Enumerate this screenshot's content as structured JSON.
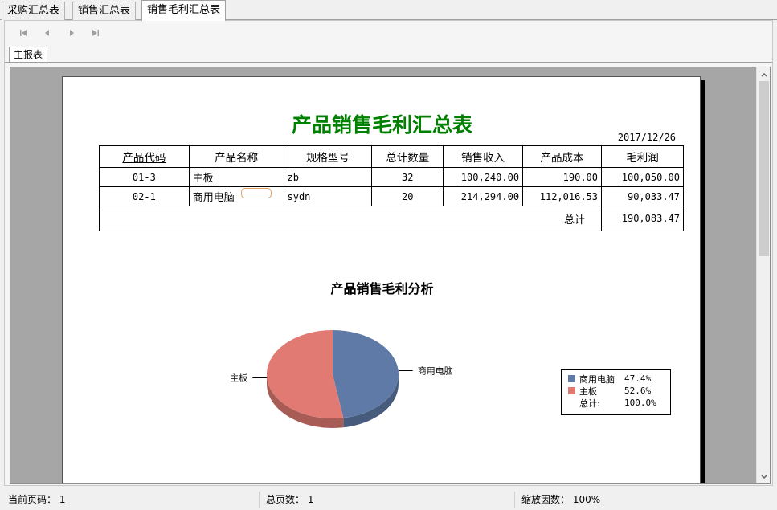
{
  "tabs": [
    {
      "label": "采购汇总表",
      "active": false
    },
    {
      "label": "销售汇总表",
      "active": false
    },
    {
      "label": "销售毛利汇总表",
      "active": true
    }
  ],
  "subtab": {
    "label": "主报表"
  },
  "report": {
    "title": "产品销售毛利汇总表",
    "date": "2017/12/26",
    "columns": [
      "产品代码",
      "产品名称",
      "规格型号",
      "总计数量",
      "销售收入",
      "产品成本",
      "毛利润"
    ],
    "rows": [
      [
        "01-3",
        "主板",
        "zb",
        "32",
        "100,240.00",
        "190.00",
        "100,050.00"
      ],
      [
        "02-1",
        "商用电脑",
        "sydn",
        "20",
        "214,294.00",
        "112,016.53",
        "90,033.47"
      ]
    ],
    "total_label": "总计",
    "total_value": "190,083.47"
  },
  "chart_data": {
    "type": "pie",
    "title": "产品销售毛利分析",
    "slices": [
      {
        "name": "商用电脑",
        "percent": 47.4,
        "value": 90033.47,
        "color": "#5f7aa6"
      },
      {
        "name": "主板",
        "percent": 52.6,
        "value": 100050.0,
        "color": "#e07a72"
      }
    ],
    "legend": {
      "placement": "right",
      "items": [
        {
          "name": "商用电脑",
          "pct_text": "47.4%"
        },
        {
          "name": "主板",
          "pct_text": "52.6%"
        }
      ],
      "total_name": "总计:",
      "total_pct": "100.0%"
    }
  },
  "status": {
    "current_page_label": "当前页码：",
    "current_page": "1",
    "total_pages_label": "总页数：",
    "total_pages": "1",
    "zoom_label": "缩放因数：",
    "zoom": "100%"
  }
}
